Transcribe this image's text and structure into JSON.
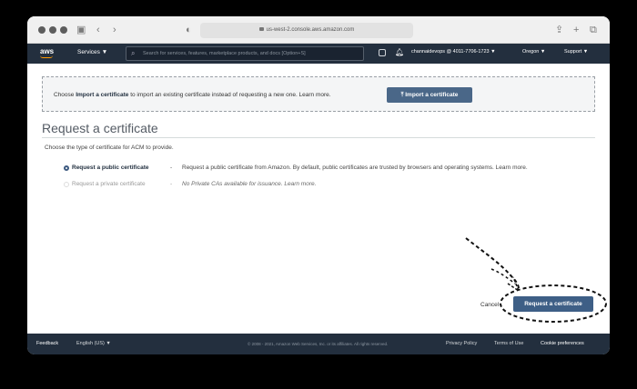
{
  "browser": {
    "url": "us-west-2.console.aws.amazon.com"
  },
  "nav": {
    "logo": "aws",
    "services": "Services ▼",
    "search_placeholder": "Search for services, features, marketplace products, and docs  [Option+S]",
    "account": "channaidevops @ 4011-7706-1723 ▼",
    "region": "Oregon ▼",
    "support": "Support ▼"
  },
  "banner": {
    "text_prefix": "Choose ",
    "text_link": "Import a certificate",
    "text_suffix": " to import an existing certificate instead of requesting a new one. Learn more.",
    "button": "Import a certificate"
  },
  "page": {
    "title": "Request a certificate",
    "description": "Choose the type of certificate for ACM to provide."
  },
  "options": [
    {
      "label": "Request a public certificate",
      "dash": "-",
      "desc": "Request a public certificate from Amazon. By default, public certificates are trusted by browsers and operating systems. Learn more.",
      "selected": true
    },
    {
      "label": "Request a private certificate",
      "dash": "-",
      "desc": "No Private CAs available for issuance. Learn more.",
      "selected": false
    }
  ],
  "actions": {
    "cancel": "Cancel",
    "submit": "Request a certificate"
  },
  "footer": {
    "feedback": "Feedback",
    "language": "English (US) ▼",
    "copyright": "© 2008 - 2021, Amazon Web Services, Inc. or its affiliates. All rights reserved.",
    "privacy": "Privacy Policy",
    "terms": "Terms of Use",
    "cookies": "Cookie preferences"
  },
  "colors": {
    "nav_bg": "#232f3e",
    "button": "#4a6788",
    "accent": "#ff9900"
  }
}
